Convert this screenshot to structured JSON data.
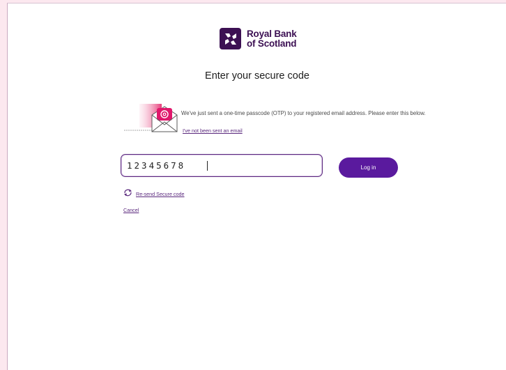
{
  "brand": {
    "name_line1": "Royal Bank",
    "name_line2": "of Scotland",
    "color": "#3c1053"
  },
  "page": {
    "title": "Enter your secure code"
  },
  "otp": {
    "message": "We've just sent a one-time passcode (OTP) to your registered email address. Please enter this below.",
    "not_sent_link": "I've not been sent an email",
    "envelope_icon": "email-envelope-icon"
  },
  "form": {
    "code_value": "12345678",
    "login_label": "Log in",
    "accent_color": "#5a1a9e"
  },
  "links": {
    "resend_label": "Re-send Secure code",
    "resend_icon": "refresh-icon",
    "cancel_label": "Cancel"
  }
}
